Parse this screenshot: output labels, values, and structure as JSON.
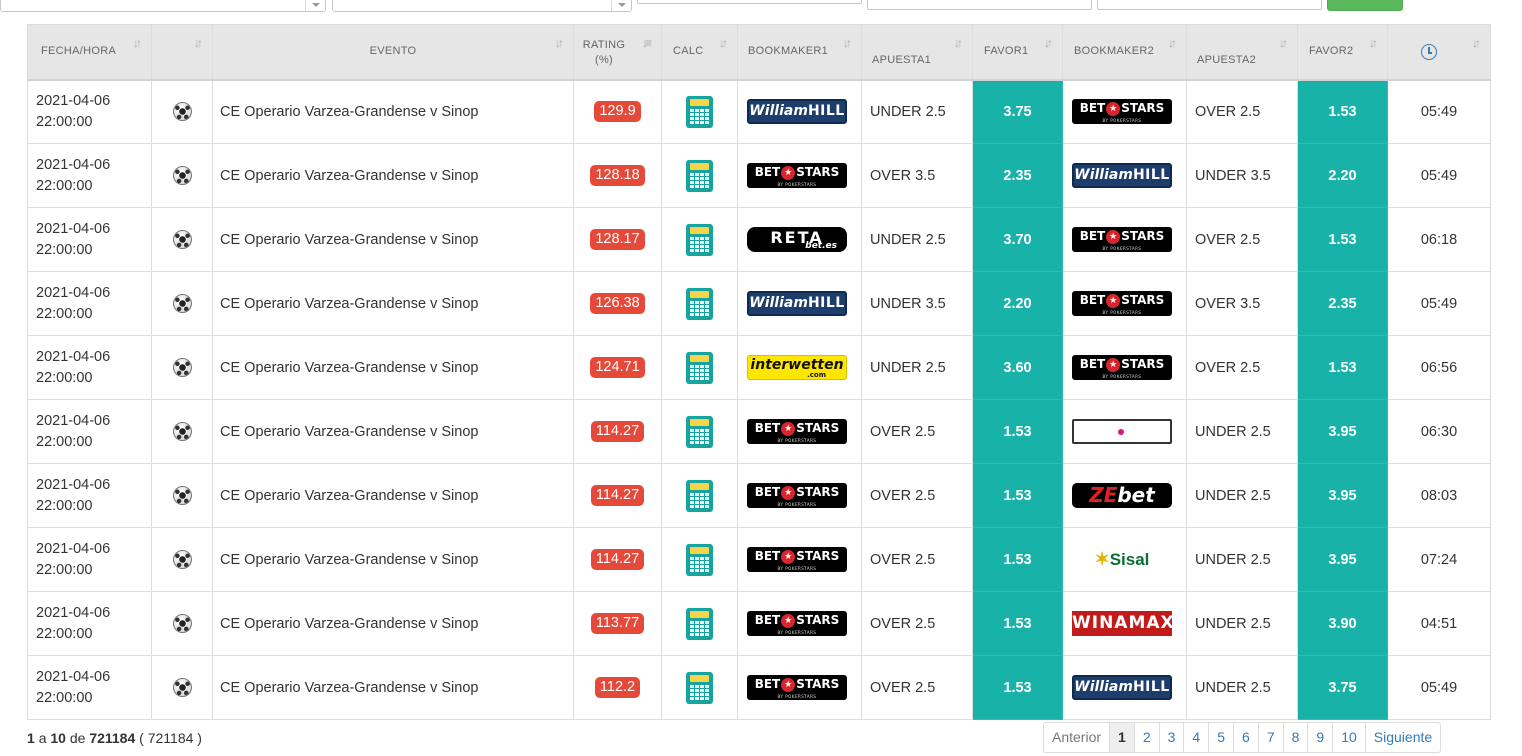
{
  "headers": {
    "fecha": "FECHA/HORA",
    "evento": "EVENTO",
    "rating_line1": "RATING",
    "rating_line2": "(%)",
    "calc": "CALC",
    "bookmaker1": "BOOKMAKER1",
    "apuesta1": "APUESTA1",
    "favor1": "FAVOR1",
    "bookmaker2": "BOOKMAKER2",
    "apuesta2": "APUESTA2",
    "favor2": "FAVOR2"
  },
  "rows": [
    {
      "date": "2021-04-06",
      "time": "22:00:00",
      "event": "CE Operario Varzea-Grandense v Sinop",
      "rating": "129.9",
      "bk1": "williamhill",
      "bet1": "UNDER 2.5",
      "odd1": "3.75",
      "bk2": "betstars",
      "bet2": "OVER 2.5",
      "odd2": "1.53",
      "updated": "05:49"
    },
    {
      "date": "2021-04-06",
      "time": "22:00:00",
      "event": "CE Operario Varzea-Grandense v Sinop",
      "rating": "128.18",
      "bk1": "betstars",
      "bet1": "OVER 3.5",
      "odd1": "2.35",
      "bk2": "williamhill",
      "bet2": "UNDER 3.5",
      "odd2": "2.20",
      "updated": "05:49"
    },
    {
      "date": "2021-04-06",
      "time": "22:00:00",
      "event": "CE Operario Varzea-Grandense v Sinop",
      "rating": "128.17",
      "bk1": "retabet",
      "bet1": "UNDER 2.5",
      "odd1": "3.70",
      "bk2": "betstars",
      "bet2": "OVER 2.5",
      "odd2": "1.53",
      "updated": "06:18"
    },
    {
      "date": "2021-04-06",
      "time": "22:00:00",
      "event": "CE Operario Varzea-Grandense v Sinop",
      "rating": "126.38",
      "bk1": "williamhill",
      "bet1": "UNDER 3.5",
      "odd1": "2.20",
      "bk2": "betstars",
      "bet2": "OVER 3.5",
      "odd2": "2.35",
      "updated": "05:49"
    },
    {
      "date": "2021-04-06",
      "time": "22:00:00",
      "event": "CE Operario Varzea-Grandense v Sinop",
      "rating": "124.71",
      "bk1": "interwetten",
      "bet1": "UNDER 2.5",
      "odd1": "3.60",
      "bk2": "betstars",
      "bet2": "OVER 2.5",
      "odd2": "1.53",
      "updated": "06:56"
    },
    {
      "date": "2021-04-06",
      "time": "22:00:00",
      "event": "CE Operario Varzea-Grandense v Sinop",
      "rating": "114.27",
      "bk1": "betstars",
      "bet1": "OVER 2.5",
      "odd1": "1.53",
      "bk2": "goldenpark",
      "bet2": "UNDER 2.5",
      "odd2": "3.95",
      "updated": "06:30"
    },
    {
      "date": "2021-04-06",
      "time": "22:00:00",
      "event": "CE Operario Varzea-Grandense v Sinop",
      "rating": "114.27",
      "bk1": "betstars",
      "bet1": "OVER 2.5",
      "odd1": "1.53",
      "bk2": "zebet",
      "bet2": "UNDER 2.5",
      "odd2": "3.95",
      "updated": "08:03"
    },
    {
      "date": "2021-04-06",
      "time": "22:00:00",
      "event": "CE Operario Varzea-Grandense v Sinop",
      "rating": "114.27",
      "bk1": "betstars",
      "bet1": "OVER 2.5",
      "odd1": "1.53",
      "bk2": "sisal",
      "bet2": "UNDER 2.5",
      "odd2": "3.95",
      "updated": "07:24"
    },
    {
      "date": "2021-04-06",
      "time": "22:00:00",
      "event": "CE Operario Varzea-Grandense v Sinop",
      "rating": "113.77",
      "bk1": "betstars",
      "bet1": "OVER 2.5",
      "odd1": "1.53",
      "bk2": "winamax",
      "bet2": "UNDER 2.5",
      "odd2": "3.90",
      "updated": "04:51"
    },
    {
      "date": "2021-04-06",
      "time": "22:00:00",
      "event": "CE Operario Varzea-Grandense v Sinop",
      "rating": "112.2",
      "bk1": "betstars",
      "bet1": "OVER 2.5",
      "odd1": "1.53",
      "bk2": "williamhill",
      "bet2": "UNDER 2.5",
      "odd2": "3.75",
      "updated": "05:49"
    }
  ],
  "logos": {
    "williamhill": {
      "script": "William",
      "word": "HILL"
    },
    "betstars": {
      "left": "BET",
      "right": "STARS",
      "sub": "BY POKERSTARS"
    },
    "retabet": {
      "word": "RETA",
      "sub": "bet.es"
    },
    "interwetten": {
      "word": "interwetten",
      "sub": ".com"
    },
    "goldenpark": {
      "word": "GOLDENPARK"
    },
    "zebet": {
      "z": "ZE",
      "rest": "bet"
    },
    "sisal": {
      "word": "Sisal"
    },
    "winamax": {
      "word": "WINAMAX"
    }
  },
  "info": {
    "from": "1",
    "a": "a",
    "to": "10",
    "de": "de",
    "total": "721184",
    "filtered": "( 721184 )"
  },
  "pagination": {
    "prev": "Anterior",
    "pages": [
      "1",
      "2",
      "3",
      "4",
      "5",
      "6",
      "7",
      "8",
      "9",
      "10"
    ],
    "active": "1",
    "next": "Siguiente"
  },
  "colors": {
    "odds_bg": "#18b2a9",
    "rating_bg": "#e4493a",
    "search_button": "#5cb85c"
  },
  "icons": {
    "sport": "soccer-ball-icon",
    "calc": "calculator-icon",
    "updated_header": "clock-icon",
    "sort": "sort-arrows-icon"
  }
}
